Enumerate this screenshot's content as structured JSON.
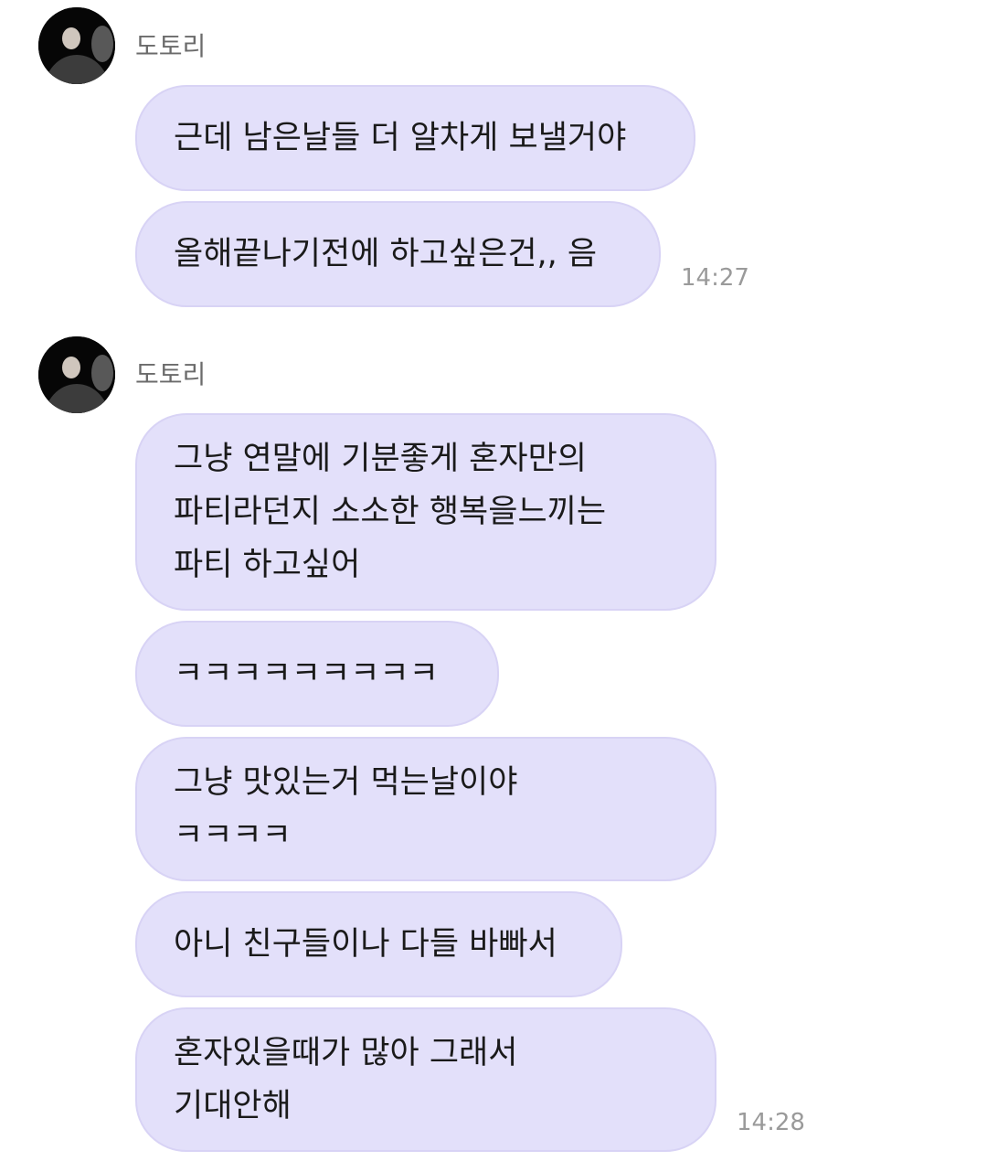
{
  "groups": [
    {
      "sender": "도토리",
      "avatar": "profile-photo",
      "messages": [
        {
          "text": "근데 남은날들 더 알차게 보낼거야"
        },
        {
          "text": "올해끝나기전에 하고싶은건,, 음"
        }
      ],
      "time": "14:27"
    },
    {
      "sender": "도토리",
      "avatar": "profile-photo",
      "messages": [
        {
          "text": "그냥 연말에 기분좋게 혼자만의\n파티라던지 소소한 행복을느끼는\n파티 하고싶어"
        },
        {
          "text": "ㅋㅋㅋㅋㅋㅋㅋㅋㅋ"
        },
        {
          "text": "그냥 맛있는거 먹는날이야\nㅋㅋㅋㅋ"
        },
        {
          "text": "아니 친구들이나 다들 바빠서"
        },
        {
          "text": "혼자있을때가 많아 그래서\n기대안해"
        }
      ],
      "time": "14:28"
    }
  ],
  "colors": {
    "bubble": "#e3e0fa",
    "bubble_border": "#d8d3f5",
    "name": "#6b6b6b",
    "time": "#9a9a9a"
  }
}
